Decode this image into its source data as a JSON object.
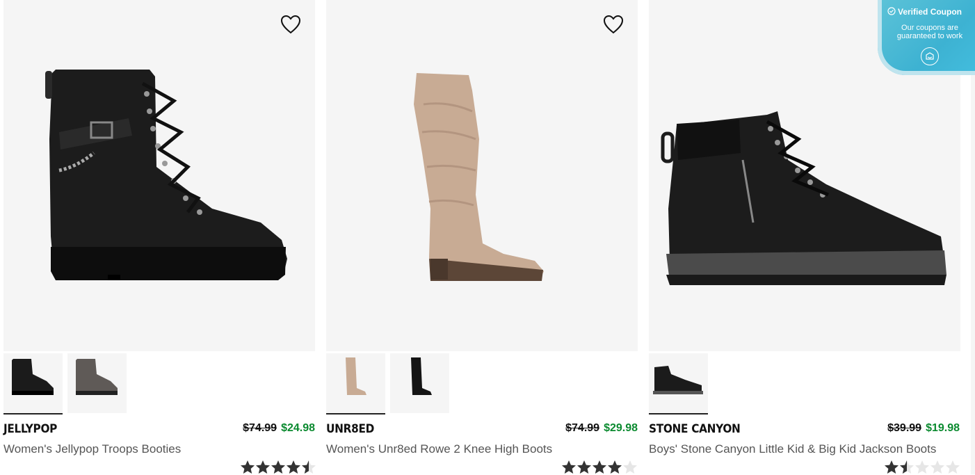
{
  "products": [
    {
      "brand": "JELLYPOP",
      "old_price": "$74.99",
      "new_price": "$24.98",
      "name": "Women's Jellypop Troops Booties",
      "rating": 4.5,
      "thumbnails": [
        "black",
        "gray"
      ]
    },
    {
      "brand": "UNR8ED",
      "old_price": "$74.99",
      "new_price": "$29.98",
      "name": "Women's Unr8ed Rowe 2 Knee High Boots",
      "rating": 4.0,
      "thumbnails": [
        "tan",
        "black"
      ]
    },
    {
      "brand": "STONE CANYON",
      "old_price": "$39.99",
      "new_price": "$19.98",
      "name": "Boys' Stone Canyon Little Kid & Big Kid Jackson Boots",
      "rating": 1.5,
      "thumbnails": [
        "black"
      ]
    }
  ],
  "coupon": {
    "title": "Verified Coupon",
    "subtitle": "Our coupons are guaranteed to work"
  },
  "colors": {
    "sale_price": "#0a8a2f",
    "coupon_bg": "#3db2d2"
  },
  "icons": {
    "wishlist": "heart-outline-icon",
    "coupon_check": "check-circle-icon",
    "coupon_open": "coupon-icon",
    "rating": "star-icon"
  }
}
